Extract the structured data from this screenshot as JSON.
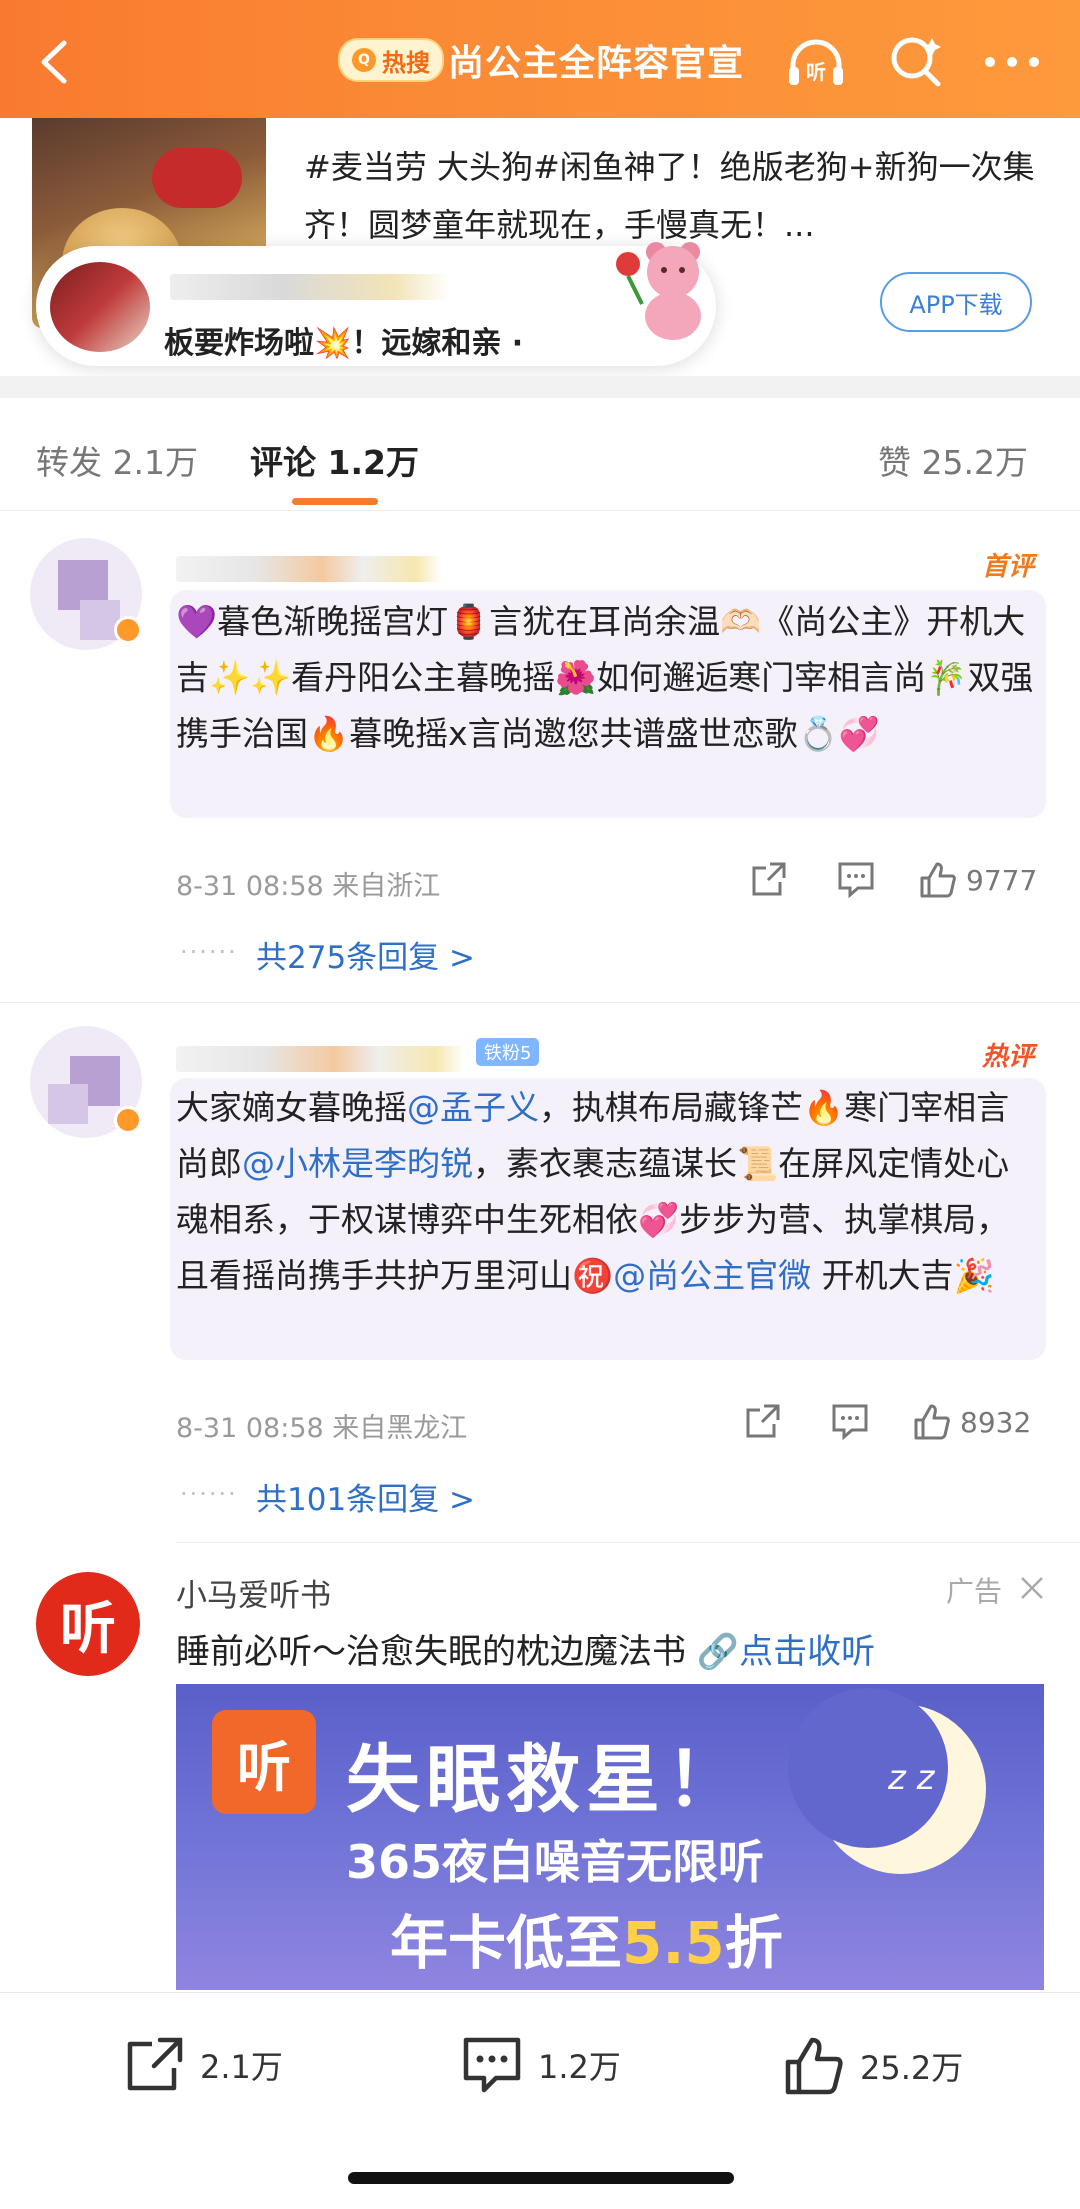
{
  "header": {
    "hot_badge": "热搜",
    "title": "尚公主全阵容官宣"
  },
  "top_card": {
    "text": "#麦当劳 大头狗#闲鱼神了！绝版老狗+新狗一次集齐！圆梦童年就现在，手慢真无！...",
    "app_button": "APP下载",
    "live_text": "板要炸场啦💥！远嫁和亲 ·"
  },
  "tabs": {
    "repost": "转发 2.1万",
    "comment": "评论 1.2万",
    "like": "赞 25.2万"
  },
  "comments": [
    {
      "tag": "首评",
      "text_parts": [
        {
          "t": "💜暮色渐晚摇宫灯🏮言犹在耳尚余温🫶🏻《尚公主》开机大吉✨✨看丹阳公主暮晚摇🌺如何邂逅寒门宰相言尚🎋双强携手治国🔥暮晚摇x言尚邀您共谱盛世恋歌💍💞"
        }
      ],
      "time": "8-31 08:58 来自浙江",
      "likes": "9777",
      "replies": "共275条回复 >"
    },
    {
      "tag": "热评",
      "fan_badge": "铁粉5",
      "text_a": "大家嫡女暮晚摇",
      "mention_a": "@孟子义",
      "text_b": "，执棋布局藏锋芒🔥寒门宰相言尚郎",
      "mention_b": "@小林是李昀锐",
      "text_c": "，素衣裹志蕴谋长📜在屏风定情处心魂相系，于权谋博弈中生死相依💞步步为营、执掌棋局，且看摇尚携手共护万里河山㊗️",
      "mention_c": "@尚公主官微",
      "text_d": " 开机大吉🎉",
      "time": "8-31 08:58 来自黑龙江",
      "likes": "8932",
      "replies": "共101条回复 >"
    }
  ],
  "ad": {
    "logo": "听",
    "name": "小马爱听书",
    "tag": "广告",
    "text": "睡前必听～治愈失眠的枕边魔法书",
    "link": "🔗点击收听",
    "banner_logo": "听",
    "banner_line1": "失眠救星！",
    "banner_line2": "365夜白噪音无限听",
    "banner_line3a": "年卡低至",
    "banner_line3b": "5.5",
    "banner_line3c": "折",
    "banner_zz": "z z"
  },
  "bottom_bar": {
    "repost": "2.1万",
    "comment": "1.2万",
    "like": "25.2万"
  },
  "colors": {
    "brand_orange": "#f97a2f",
    "link_blue": "#2f6fc8"
  }
}
